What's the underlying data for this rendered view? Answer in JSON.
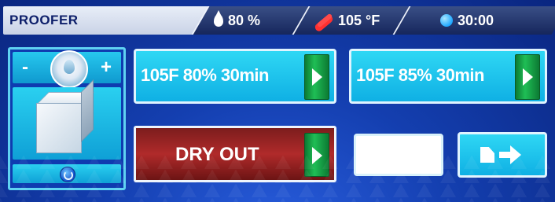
{
  "header": {
    "title": "PROOFER",
    "humidity": "80 %",
    "temperature": "105 °F",
    "timer": "30:00"
  },
  "icons": {
    "humidity": "water-drop-icon",
    "temperature": "thermometer-icon",
    "timer": "timer-icon",
    "power": "power-icon",
    "next": "arrow-right-icon"
  },
  "control_panel": {
    "decrease_label": "-",
    "increase_label": "+"
  },
  "recipes": [
    {
      "label": "105F 80% 30min"
    },
    {
      "label": "105F 85% 30min"
    }
  ],
  "dry_out": {
    "label": "DRY OUT"
  },
  "colors": {
    "background": "#0b2a8c",
    "accent": "#2fd7f4",
    "go": "#1fbe55",
    "dry_out": "#b02a2a"
  }
}
